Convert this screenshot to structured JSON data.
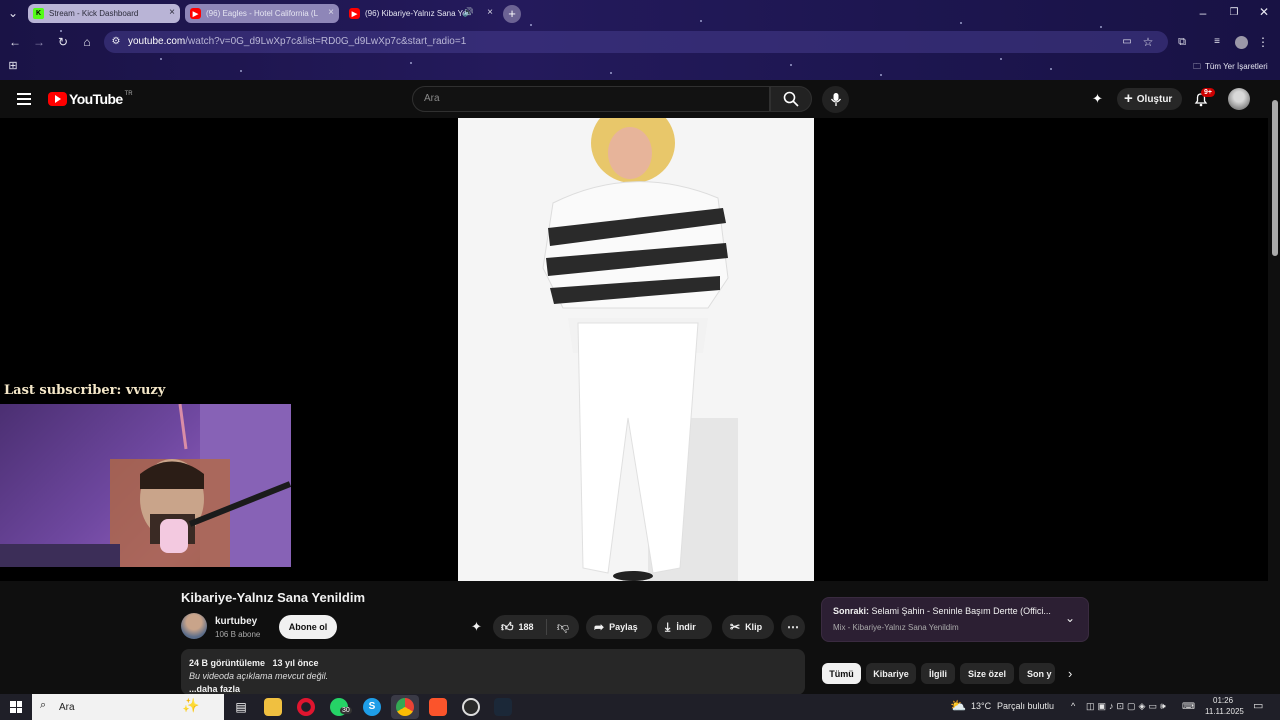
{
  "browser": {
    "tabs": [
      {
        "title": "Stream - Kick Dashboard",
        "favicon": "kick-icon",
        "active": false
      },
      {
        "title": "(96) Eagles - Hotel California (L",
        "favicon": "youtube-icon",
        "active": false
      },
      {
        "title": "(96) Kibariye-Yalnız Sana Ye",
        "favicon": "youtube-icon",
        "active": true,
        "audio": true
      }
    ],
    "url_host": "youtube.com",
    "url_path": "/watch?v=0G_d9LwXp7c&list=RD0G_d9LwXp7c&start_radio=1",
    "bookmarks_label": "Tüm Yer İşaretleri"
  },
  "youtube": {
    "logo_text": "YouTube",
    "logo_region": "TR",
    "search_placeholder": "Ara",
    "create_label": "Oluştur",
    "notification_badge": "9+"
  },
  "overlay": {
    "last_subscriber": "Last subscriber: vvuzy"
  },
  "video": {
    "title": "Kibariye-Yalnız Sana Yenildim",
    "channel": "kurtubey",
    "subscribers": "106 B abone",
    "subscribe_label": "Abone ol",
    "likes": "188",
    "share_label": "Paylaş",
    "download_label": "İndir",
    "clip_label": "Klip",
    "views": "24 B görüntüleme",
    "age": "13 yıl önce",
    "description": "Bu videoda açıklama mevcut değil.",
    "more_label": "...daha fazla"
  },
  "up_next": {
    "prefix": "Sonraki:",
    "title": "Selami Şahin - Seninle Başım Dertte (Offici...",
    "subtitle": "Mix - Kibariye-Yalnız Sana Yenildim"
  },
  "chips": [
    "Tümü",
    "Kibariye",
    "İlgili",
    "Size özel",
    "Son y"
  ],
  "taskbar": {
    "search_placeholder": "Ara",
    "whatsapp_badge": "30",
    "weather_temp": "13°C",
    "weather_text": "Parçalı bulutlu",
    "time": "01:26",
    "date": "11.11.2025"
  },
  "colors": {
    "youtube_red": "#ff0000",
    "chrome_bg": "#1e1750",
    "yt_bg": "#0f0f0f",
    "kick_green": "#53fc18"
  }
}
